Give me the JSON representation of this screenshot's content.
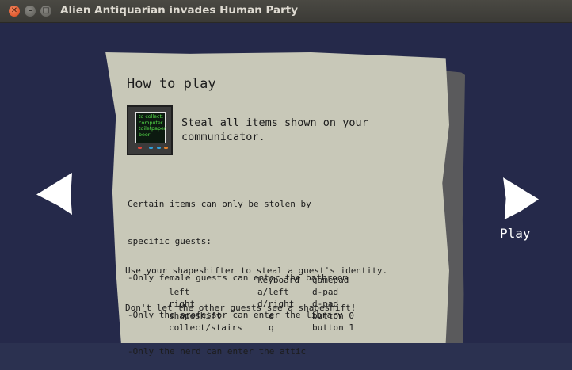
{
  "window": {
    "title": "Alien Antiquarian invades Human Party",
    "close_glyph": "✕",
    "min_glyph": "–",
    "max_glyph": "□"
  },
  "page": {
    "heading": "How to play",
    "communicator": {
      "lines": [
        "to collect:",
        "computer",
        "toiletpaper",
        "beer"
      ]
    },
    "steal_text": "Steal all items shown on your communicator.",
    "rules": [
      "Certain items can only be stolen by",
      "specific guests:",
      "-Only female guests can enter the bathroom",
      "-Only the professor can enter the library",
      "-Only the nerd can enter the attic"
    ],
    "shapeshift": [
      "Use your shapeshifter to steal a guest's identity.",
      "Don't let the other guests see a shapeshift!"
    ],
    "controls": {
      "headers": [
        "keyboard",
        "gamepad"
      ],
      "rows": [
        {
          "action": "left",
          "keyboard": "a/left",
          "gamepad": "d-pad"
        },
        {
          "action": "right",
          "keyboard": "d/right",
          "gamepad": "d-pad"
        },
        {
          "action": "shapeshift",
          "keyboard": "e",
          "gamepad": "button 0"
        },
        {
          "action": "collect/stairs",
          "keyboard": "q",
          "gamepad": "button 1"
        }
      ]
    }
  },
  "nav": {
    "play_label": "Play"
  }
}
